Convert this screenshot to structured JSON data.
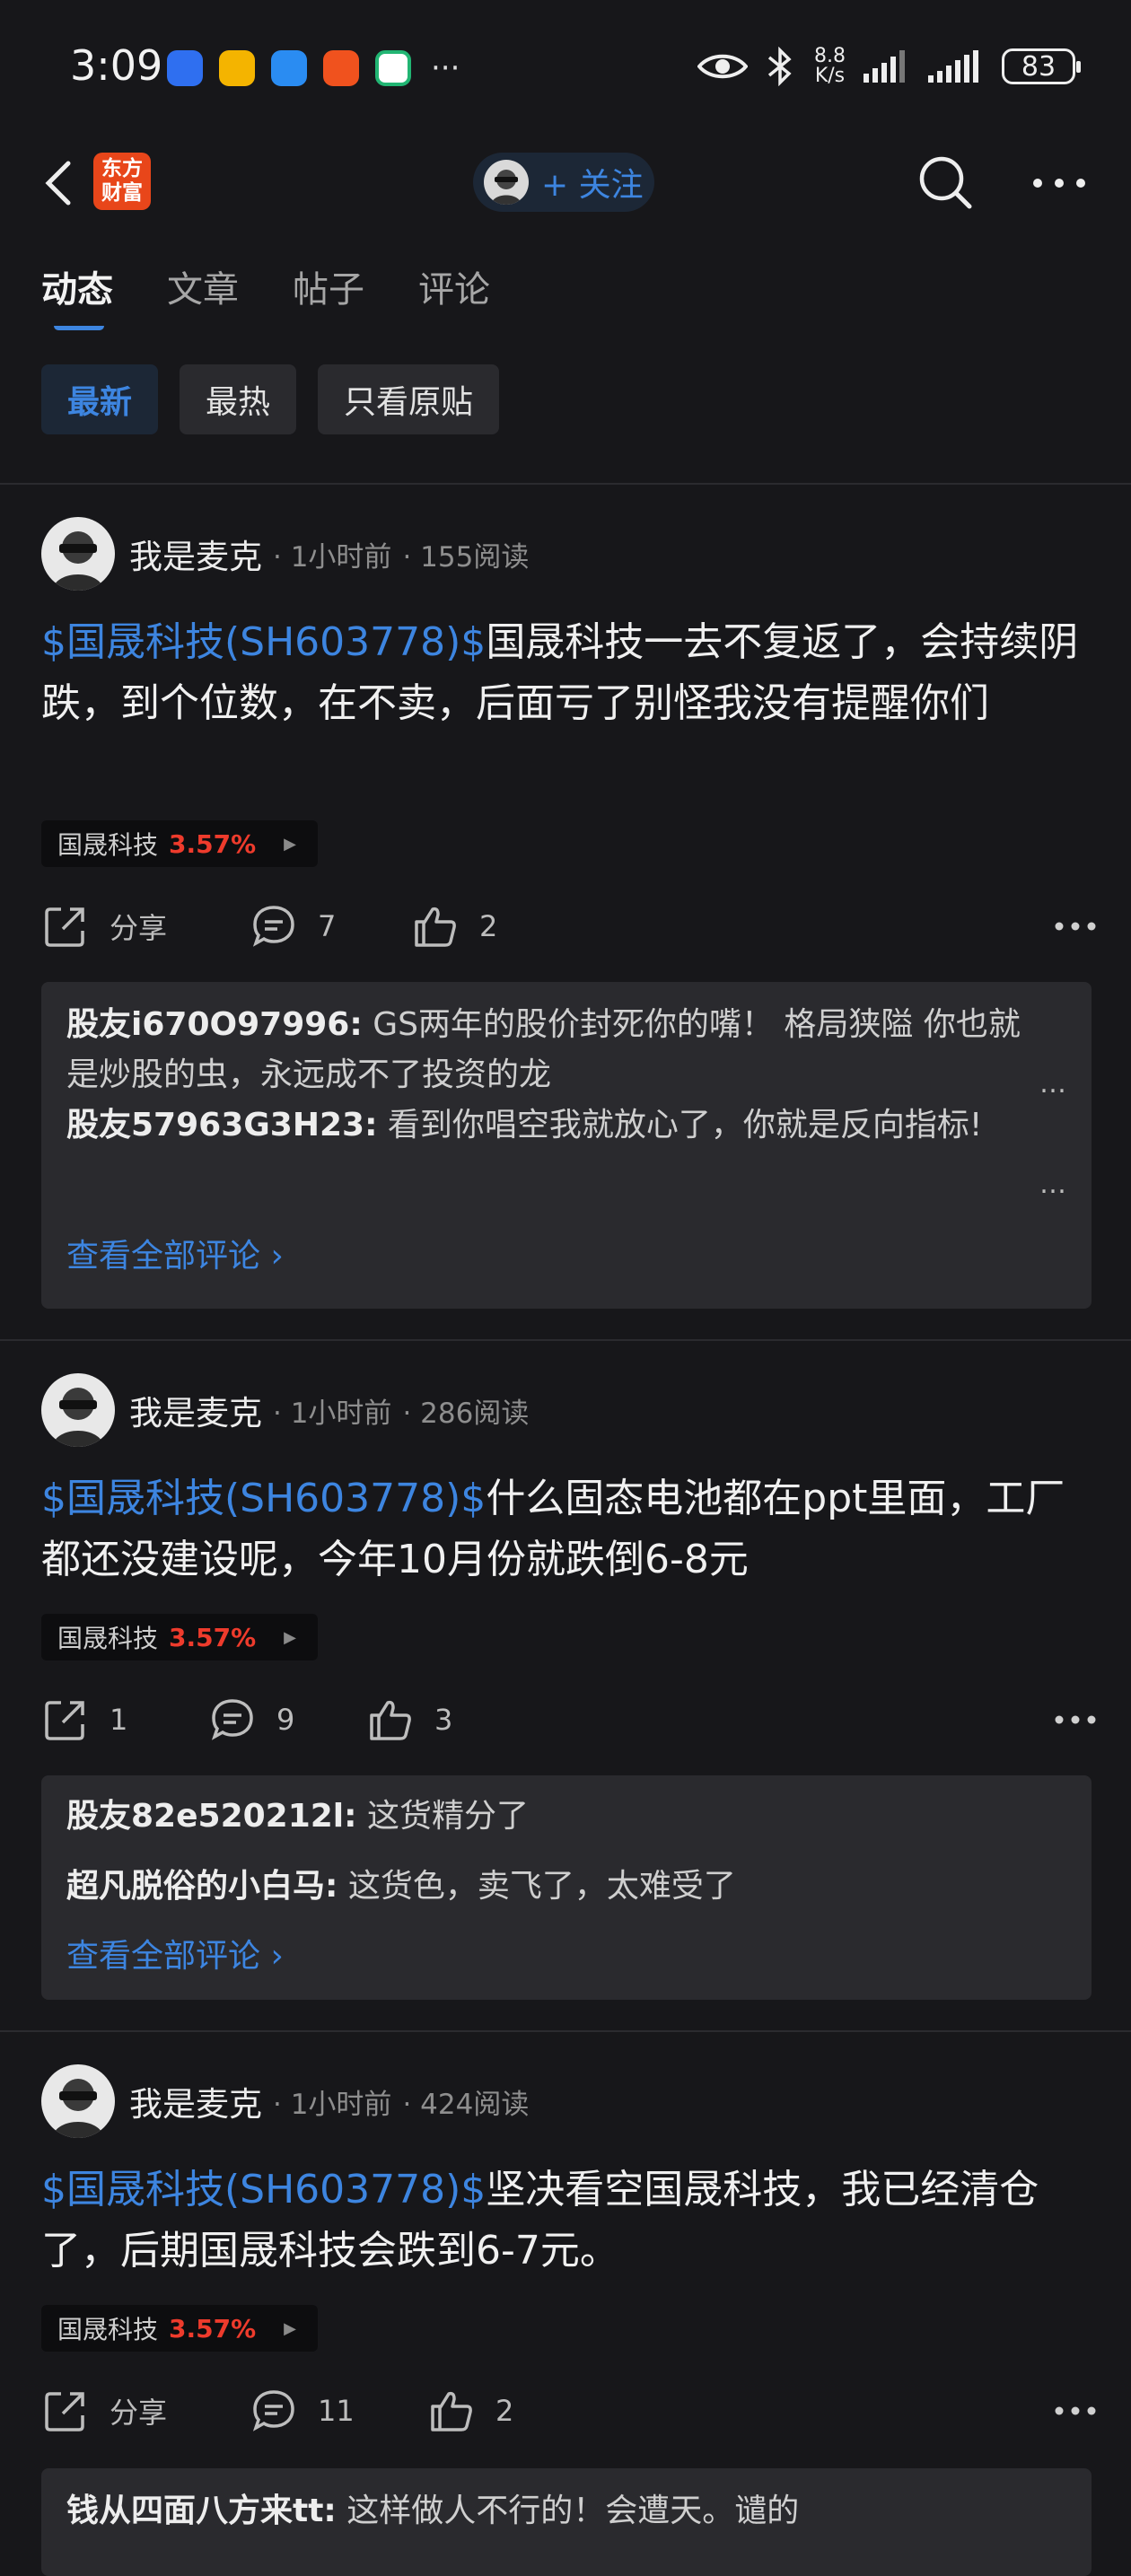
{
  "status": {
    "time": "3:09",
    "netspeed_value": "8.8",
    "netspeed_unit": "K/s",
    "battery": "83",
    "more": "···"
  },
  "header": {
    "logo_line1": "东方",
    "logo_line2": "财富",
    "follow_label": "+ 关注"
  },
  "tabs": [
    "动态",
    "文章",
    "帖子",
    "评论"
  ],
  "filters": [
    "最新",
    "最热",
    "只看原贴"
  ],
  "posts": [
    {
      "author": "我是麦克",
      "time": "· 1小时前",
      "reads": "· 155阅读",
      "tag": "$国晟科技(SH603778)$",
      "text": "国晟科技一去不复返了，会持续阴跌，到个位数，在不卖，后面亏了别怪我没有提醒你们",
      "stock_name": "国晟科技",
      "stock_change": "3.57%",
      "share": "分享",
      "comments_count": "7",
      "likes": "2",
      "comments": [
        {
          "user": "股友i670O97996:",
          "text": "GS两年的股价封死你的嘴！ 格局狭隘 你也就是炒股的虫，永远成不了投资的龙"
        },
        {
          "user": "股友57963G3H23:",
          "text": "看到你唱空我就放心了，你就是反向指标!"
        }
      ],
      "view_all": "查看全部评论 ›"
    },
    {
      "author": "我是麦克",
      "time": "· 1小时前",
      "reads": "· 286阅读",
      "tag": "$国晟科技(SH603778)$",
      "text": "什么固态电池都在ppt里面，工厂都还没建设呢，今年10月份就跌倒6-8元",
      "stock_name": "国晟科技",
      "stock_change": "3.57%",
      "share": "1",
      "comments_count": "9",
      "likes": "3",
      "comments": [
        {
          "user": "股友82e520212l:",
          "text": "这货精分了"
        },
        {
          "user": "超凡脱俗的小白马:",
          "text": "这货色，卖飞了，太难受了"
        }
      ],
      "view_all": "查看全部评论 ›"
    },
    {
      "author": "我是麦克",
      "time": "· 1小时前",
      "reads": "· 424阅读",
      "tag": "$国晟科技(SH603778)$",
      "text": "坚决看空国晟科技，我已经清仓了，后期国晟科技会跌到6-7元。",
      "stock_name": "国晟科技",
      "stock_change": "3.57%",
      "share": "分享",
      "comments_count": "11",
      "likes": "2",
      "comments": [
        {
          "user": "钱从四面八方来tt:",
          "text": "这样做人不行的！会遭天。谴的"
        }
      ]
    }
  ]
}
